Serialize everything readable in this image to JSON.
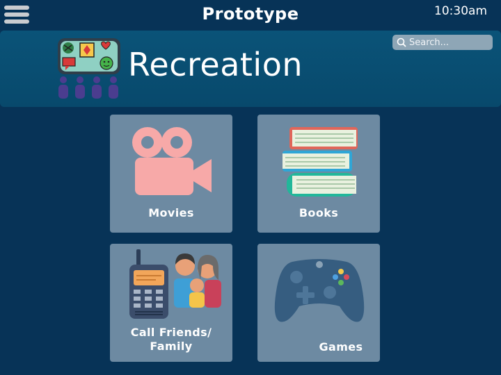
{
  "header": {
    "title": "Prototype",
    "time": "10:30am"
  },
  "hero": {
    "title": "Recreation",
    "search_placeholder": "Search..."
  },
  "tiles": [
    {
      "label": "Movies"
    },
    {
      "label": "Books"
    },
    {
      "label": "Call Friends/ Family"
    },
    {
      "label": "Games"
    }
  ],
  "icons": {
    "menu": "hamburger-menu-icon",
    "search": "search-icon",
    "recreation": "recreation-board-icon",
    "movies": "movie-camera-icon",
    "books": "books-stack-icon",
    "call": "walkie-talkie-family-icon",
    "games": "game-controller-icon"
  },
  "colors": {
    "background": "#073357",
    "hero": "#0a5378",
    "tile": "#6d8aa2",
    "camera": "#f7a9a8"
  }
}
